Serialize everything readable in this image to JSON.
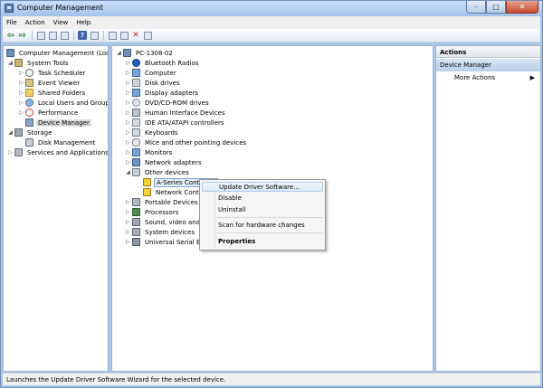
{
  "window": {
    "title": "Computer Management"
  },
  "menu": [
    "File",
    "Action",
    "View",
    "Help"
  ],
  "left_tree": {
    "root": "Computer Management (Local",
    "system_tools": "System Tools",
    "task_scheduler": "Task Scheduler",
    "event_viewer": "Event Viewer",
    "shared_folders": "Shared Folders",
    "local_users": "Local Users and Groups",
    "performance": "Performance",
    "device_manager": "Device Manager",
    "storage": "Storage",
    "disk_management": "Disk Management",
    "services": "Services and Applications"
  },
  "device_tree": {
    "root": "PC-1308-02",
    "bluetooth": "Bluetooth Radios",
    "computer": "Computer",
    "disk_drives": "Disk drives",
    "display": "Display adapters",
    "dvd": "DVD/CD-ROM drives",
    "hid": "Human Interface Devices",
    "ide": "IDE ATA/ATAPI controllers",
    "keyboards": "Keyboards",
    "mice": "Mice and other pointing devices",
    "monitors": "Monitors",
    "network": "Network adapters",
    "other": "Other devices",
    "aseries": "A-Series Controller",
    "netctrl": "Network Contro",
    "portable": "Portable Devices",
    "processors": "Processors",
    "sound": "Sound, video and g",
    "system": "System devices",
    "usb": "Universal Serial Bus"
  },
  "actions": {
    "header": "Actions",
    "section": "Device Manager",
    "more": "More Actions",
    "more_arrow": "▶"
  },
  "context_menu": {
    "update": "Update Driver Software...",
    "disable": "Disable",
    "uninstall": "Uninstall",
    "scan": "Scan for hardware changes",
    "properties": "Properties"
  },
  "status": "Launches the Update Driver Software Wizard for the selected device."
}
